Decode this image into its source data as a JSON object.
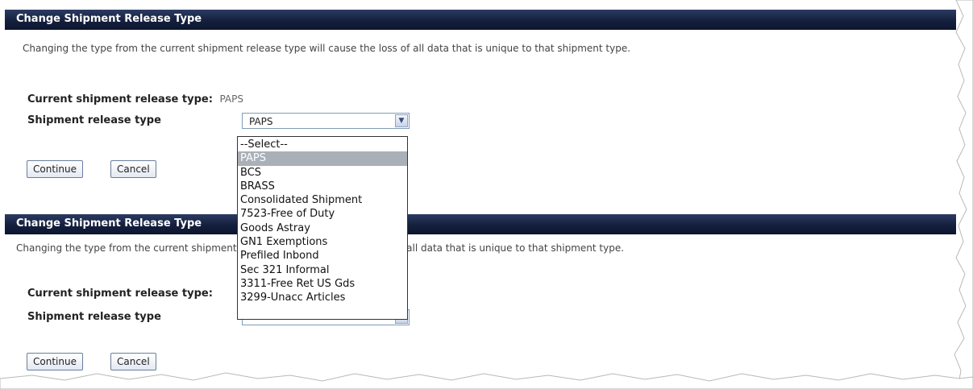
{
  "panels": [
    {
      "title": "Change Shipment Release Type",
      "description": "Changing the type from the current shipment release type will cause the loss of all data that is unique to that shipment type.",
      "current_label": "Current shipment release type:",
      "current_value": "PAPS",
      "select_label": "Shipment release type",
      "select_value": "PAPS",
      "continue_label": "Continue",
      "cancel_label": "Cancel"
    },
    {
      "title": "Change Shipment Release Type",
      "description": "Changing the type from the current shipment release type will cause the loss of all data that is unique to that shipment type.",
      "current_label": "Current shipment release type:",
      "select_label": "Shipment release type",
      "continue_label": "Continue",
      "cancel_label": "Cancel"
    }
  ],
  "dropdown": {
    "options": [
      "--Select--",
      "PAPS",
      "BCS",
      "BRASS",
      "Consolidated Shipment",
      "7523-Free of Duty",
      "Goods Astray",
      "GN1 Exemptions",
      "Prefiled Inbond",
      "Sec 321 Informal",
      "3311-Free Ret US Gds",
      "3299-Unacc Articles"
    ],
    "selected": "PAPS"
  },
  "colors": {
    "header_bg": "#15203e",
    "header_text": "#ffffff",
    "selected_option_bg": "#aab0b8"
  },
  "icons": {
    "select_arrow": "chevron-down-icon"
  }
}
